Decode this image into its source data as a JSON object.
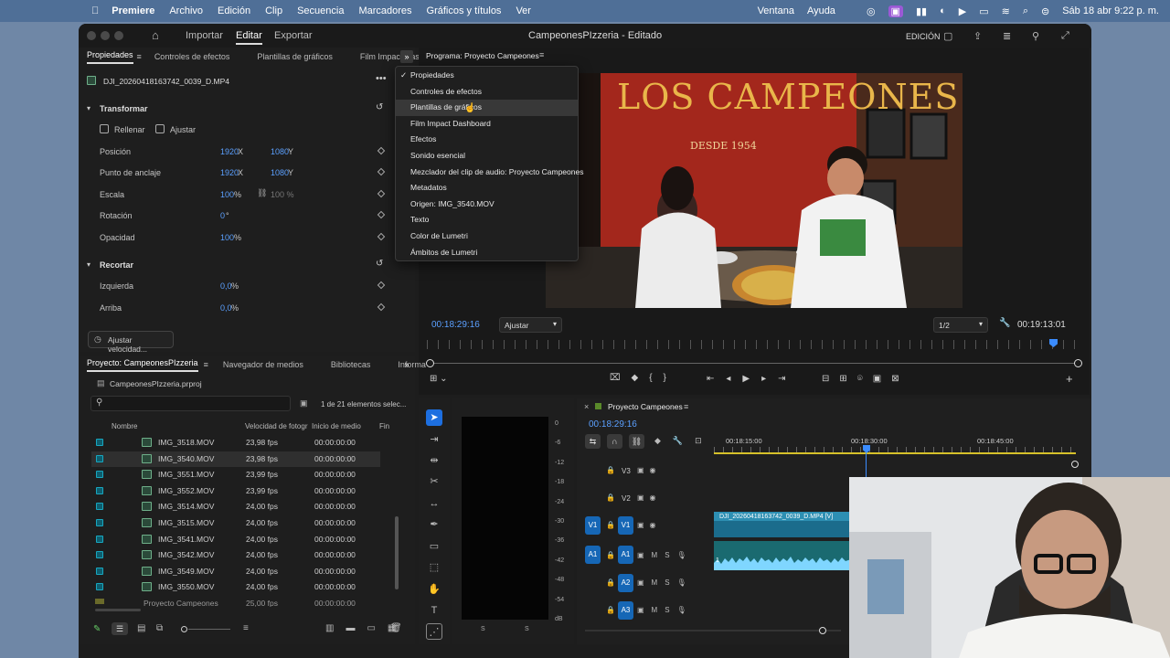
{
  "menubar": {
    "apple": "",
    "items": [
      "Premiere",
      "Archivo",
      "Edición",
      "Clip",
      "Secuencia",
      "Marcadores",
      "Gráficos y títulos",
      "Ver"
    ],
    "right": [
      "Ventana",
      "Ayuda"
    ],
    "datetime": "Sáb 18 abr 9:22 p. m."
  },
  "window": {
    "nav": {
      "import": "Importar",
      "edit": "Editar",
      "export": "Exportar"
    },
    "title": "CampeonesPIzzeria - Editado",
    "mode": "EDICIÓN"
  },
  "left_tabs": [
    "Propiedades",
    "Controles de efectos",
    "Plantillas de gráficos",
    "Film Impact Dash"
  ],
  "properties": {
    "clip_name": "DJI_20260418163742_0039_D.MP4",
    "transform_title": "Transformar",
    "fill_label": "Rellenar",
    "fit_label": "Ajustar",
    "rows": [
      {
        "label": "Posición",
        "v1": "1920",
        "u1": "X",
        "v2": "1080",
        "u2": "Y"
      },
      {
        "label": "Punto de anclaje",
        "v1": "1920",
        "u1": "X",
        "v2": "1080",
        "u2": "Y"
      },
      {
        "label": "Escala",
        "v1": "100",
        "u1": "%",
        "v2": "100 %",
        "u2": ""
      },
      {
        "label": "Rotación",
        "v1": "0",
        "u1": "°",
        "v2": "",
        "u2": ""
      },
      {
        "label": "Opacidad",
        "v1": "100",
        "u1": "%",
        "v2": "",
        "u2": ""
      }
    ],
    "crop_title": "Recortar",
    "crop_rows": [
      {
        "label": "Izquierda",
        "value": "0,0",
        "unit": "%"
      },
      {
        "label": "Arriba",
        "value": "0,0",
        "unit": "%"
      }
    ],
    "speed_button": "Ajustar velocidad..."
  },
  "program": {
    "tab": "Programa: Proyecto Campeones",
    "timecode": "00:18:29:16",
    "fit": "Ajustar",
    "resolution": "1/2",
    "duration": "00:19:13:01"
  },
  "dropdown": {
    "items": [
      {
        "label": "Propiedades",
        "checked": true
      },
      {
        "label": "Controles de efectos"
      },
      {
        "label": "Plantillas de gráficos",
        "hover": true
      },
      {
        "label": "Film Impact Dashboard"
      },
      {
        "label": "Efectos"
      },
      {
        "label": "Sonido esencial"
      },
      {
        "label": "Mezclador del clip de audio: Proyecto Campeones"
      },
      {
        "label": "Metadatos"
      },
      {
        "label": "Origen: IMG_3540.MOV"
      },
      {
        "label": "Texto"
      },
      {
        "label": "Color de Lumetri"
      },
      {
        "label": "Ámbitos de Lumetri"
      }
    ]
  },
  "project": {
    "tabs": [
      "Proyecto: CampeonesPIzzeria",
      "Navegador de medios",
      "Bibliotecas",
      "Informa"
    ],
    "file": "CampeonesPIzzeria.prproj",
    "selection": "1 de 21 elementos selec...",
    "columns": [
      "Nombre",
      "Velocidad de fotogr",
      "Inicio de medio",
      "Fin"
    ],
    "rows": [
      {
        "name": "IMG_3518.MOV",
        "fps": "23,98 fps",
        "start": "00:00:00:00"
      },
      {
        "name": "IMG_3540.MOV",
        "fps": "23,98 fps",
        "start": "00:00:00:00",
        "selected": true
      },
      {
        "name": "IMG_3551.MOV",
        "fps": "23,99 fps",
        "start": "00:00:00:00"
      },
      {
        "name": "IMG_3552.MOV",
        "fps": "23,99 fps",
        "start": "00:00:00:00"
      },
      {
        "name": "IMG_3514.MOV",
        "fps": "24,00 fps",
        "start": "00:00:00:00"
      },
      {
        "name": "IMG_3515.MOV",
        "fps": "24,00 fps",
        "start": "00:00:00:00"
      },
      {
        "name": "IMG_3541.MOV",
        "fps": "24,00 fps",
        "start": "00:00:00:00"
      },
      {
        "name": "IMG_3542.MOV",
        "fps": "24,00 fps",
        "start": "00:00:00:00"
      },
      {
        "name": "IMG_3549.MOV",
        "fps": "24,00 fps",
        "start": "00:00:00:00"
      },
      {
        "name": "IMG_3550.MOV",
        "fps": "24,00 fps",
        "start": "00:00:00:00"
      }
    ],
    "partial_row": {
      "name": "Proyecto Campeones",
      "fps": "25,00 fps",
      "start": "00:00:00:00"
    }
  },
  "timeline": {
    "tab": "Proyecto Campeones",
    "timecode": "00:18:29:16",
    "ruler": [
      "00:18:15:00",
      "00:18:30:00",
      "00:18:45:00"
    ],
    "tracks": [
      "V3",
      "V2",
      "V1",
      "A1",
      "A2",
      "A3"
    ],
    "clip_label": "DJI_20260418163742_0039_D.MP4 [V]",
    "audio_num": "1",
    "meter_db": [
      "0",
      "-6",
      "-12",
      "-18",
      "-24",
      "-30",
      "-36",
      "-42",
      "-48",
      "-54",
      "dB"
    ],
    "meter_ss": [
      "S",
      "S"
    ]
  },
  "video": {
    "sign": "LOS CAMPEONES",
    "since": "DESDE 1954"
  }
}
